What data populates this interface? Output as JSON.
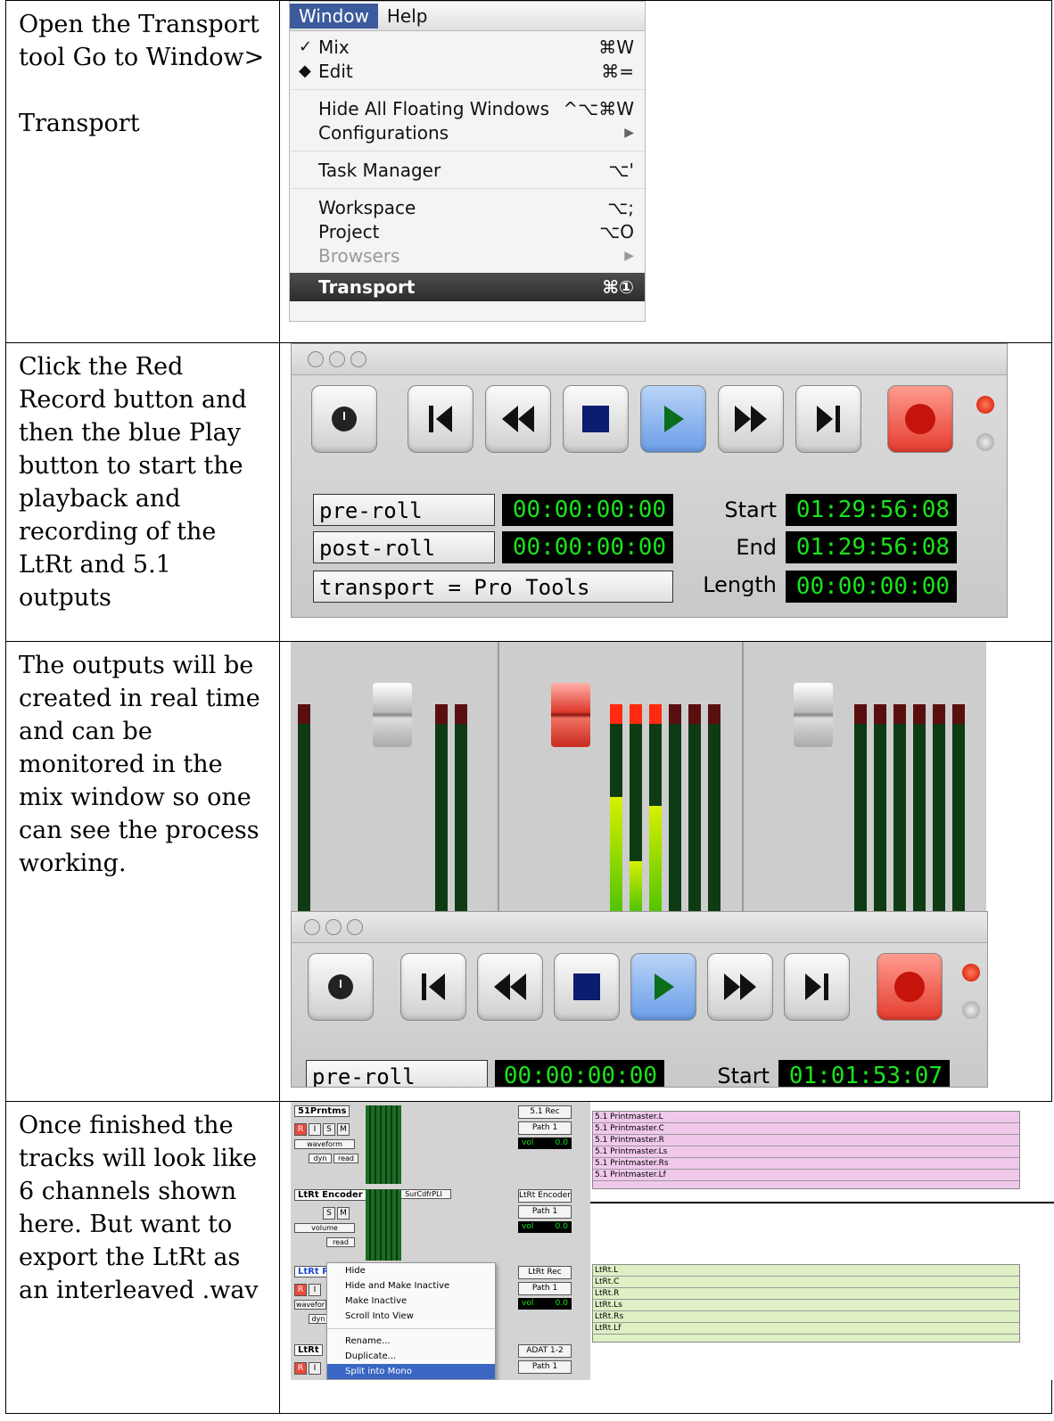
{
  "rows": [
    {
      "text": "Open the Transport tool Go to Window>\n\nTransport"
    },
    {
      "text": "Click the Red Record button and then the blue Play button to start the playback and recording of the LtRt and 5.1 outputs"
    },
    {
      "text": "The outputs will be created in real time and can be monitored in the mix window so one can see the process working."
    },
    {
      "text": "Once finished the tracks will look like 6 channels shown here.  But want to export the LtRt as an interleaved .wav"
    }
  ],
  "menu": {
    "bar": [
      "Window",
      "Help"
    ],
    "items": [
      {
        "mark": "✓",
        "label": "Mix",
        "shortcut": "⌘W"
      },
      {
        "mark": "◆",
        "label": "Edit",
        "shortcut": "⌘="
      },
      {
        "label": "Hide All Floating Windows",
        "shortcut": "^⌥⌘W"
      },
      {
        "label": "Configurations",
        "shortcut": "▶"
      },
      {
        "label": "Task Manager",
        "shortcut": "⌥'"
      },
      {
        "label": "Workspace",
        "shortcut": "⌥;"
      },
      {
        "label": "Project",
        "shortcut": "⌥O"
      },
      {
        "label": "Browsers",
        "shortcut": "▶"
      },
      {
        "label": "Transport",
        "shortcut": "⌘①"
      }
    ]
  },
  "transport1": {
    "preroll_label": "pre-roll",
    "preroll_tc": "00:00:00:00",
    "postroll_label": "post-roll",
    "postroll_tc": "00:00:00:00",
    "transport_label": "transport = Pro Tools",
    "start_label": "Start",
    "start_tc": "01:29:56:08",
    "end_label": "End",
    "end_tc": "01:29:56:08",
    "length_label": "Length",
    "length_tc": "00:00:00:00"
  },
  "transport2": {
    "preroll_label": "pre-roll",
    "preroll_tc": "00:00:00:00",
    "start_label": "Start",
    "start_tc": "01:01:53:07"
  },
  "tracks": {
    "track1": {
      "name": "51Prntms",
      "view": "waveform",
      "auto": "dyn",
      "mode": "read",
      "io1": "5.1 Rec",
      "io2": "Path 1",
      "vol": "vol",
      "volval": "0.0"
    },
    "track2": {
      "name": "LtRt Encoder",
      "insert": "SurCdfrPLI",
      "view": "volume",
      "mode": "read",
      "io1": "LtRt Encoder",
      "io2": "Path 1",
      "vol": "vol",
      "volval": "0.0"
    },
    "track3": {
      "name": "LtRt Re",
      "view": "wavefor",
      "auto": "dyn",
      "io1": "LtRt Rec",
      "io2": "Path 1",
      "vol": "vol",
      "volval": "0.0"
    },
    "track4": {
      "name": "LtRt",
      "io1": "ADAT 1-2",
      "io2": "Path 1"
    },
    "clips51": [
      "5.1 Printmaster.L",
      "5.1 Printmaster.C",
      "5.1 Printmaster.R",
      "5.1 Printmaster.Ls",
      "5.1 Printmaster.Rs",
      "5.1 Printmaster.Lf"
    ],
    "clipsltrt": [
      "LtRt.L",
      "LtRt.C",
      "LtRt.R",
      "LtRt.Ls",
      "LtRt.Rs",
      "LtRt.Lf"
    ],
    "context": [
      "Hide",
      "Hide and Make Inactive",
      "Make Inactive",
      "Scroll Into View",
      "Rename...",
      "Duplicate...",
      "Split into Mono"
    ]
  }
}
